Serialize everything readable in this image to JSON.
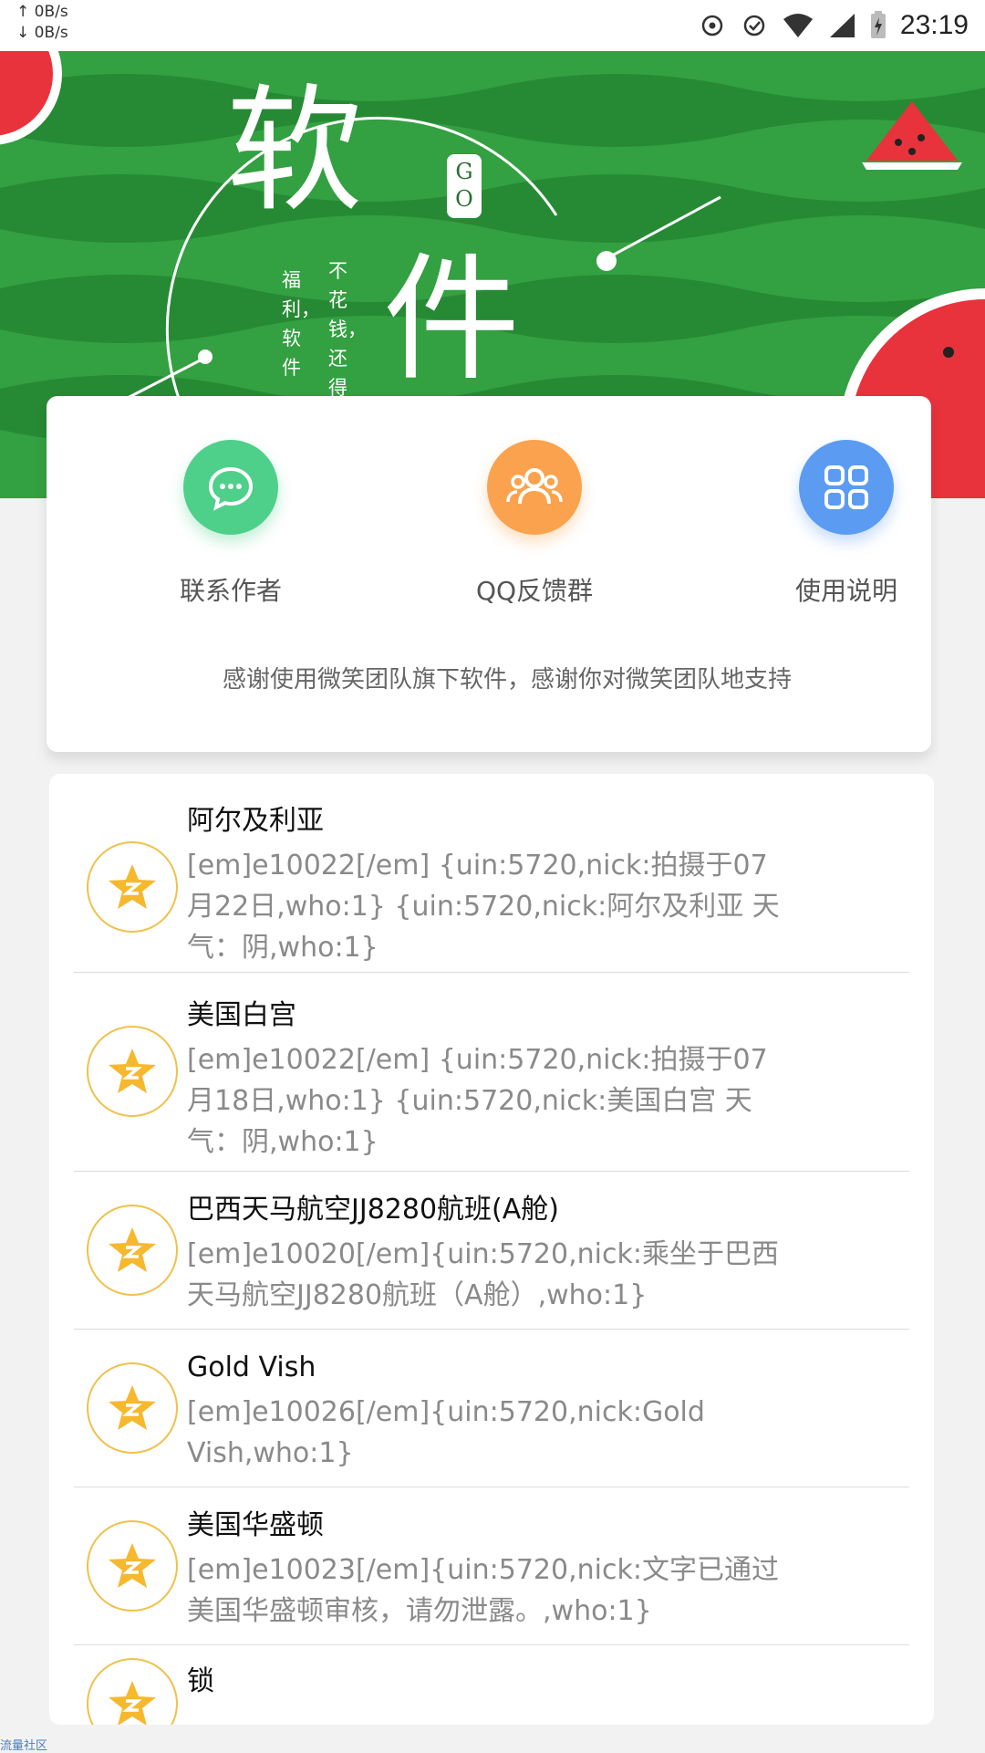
{
  "status_bar": {
    "upload_speed": "↑ 0B/s",
    "download_speed": "↓ 0B/s",
    "time": "23:19",
    "icons": [
      "sync-icon",
      "check-circle-icon",
      "wifi-icon",
      "cell-signal-icon",
      "battery-charging-icon"
    ]
  },
  "banner": {
    "word1": "软",
    "word2": "件",
    "go_tag": "G O",
    "vertical_text_1": "福利，软件",
    "vertical_text_2": "不花钱，还得"
  },
  "actions": [
    {
      "label": "联系作者",
      "icon": "chat-bubble-icon",
      "color": "#4fd08a"
    },
    {
      "label": "QQ反馈群",
      "icon": "group-icon",
      "color": "#fba24e"
    },
    {
      "label": "使用说明",
      "icon": "grid-apps-icon",
      "color": "#5b9cf2"
    }
  ],
  "thanks_text": "感谢使用微笑团队旗下软件，感谢你对微笑团队地支持",
  "items": [
    {
      "title": "阿尔及利亚",
      "desc": "[em]e10022[/em] {uin:5720,nick:拍摄于07月22日,who:1} {uin:5720,nick:阿尔及利亚 天气：阴,who:1}"
    },
    {
      "title": "美国白宫",
      "desc": "[em]e10022[/em] {uin:5720,nick:拍摄于07月18日,who:1} {uin:5720,nick:美国白宫 天气：阴,who:1}"
    },
    {
      "title": "巴西天马航空JJ8280航班(A舱)",
      "desc": "[em]e10020[/em]{uin:5720,nick:乘坐于巴西天马航空JJ8280航班（A舱）,who:1}"
    },
    {
      "title": "Gold Vish",
      "desc": "[em]e10026[/em]{uin:5720,nick:Gold Vish,who:1}"
    },
    {
      "title": "美国华盛顿",
      "desc": "[em]e10023[/em]{uin:5720,nick:文字已通过美国华盛顿审核，请勿泄露。,who:1}"
    },
    {
      "title": "锁",
      "desc": ""
    }
  ],
  "watermark": "流量社区"
}
